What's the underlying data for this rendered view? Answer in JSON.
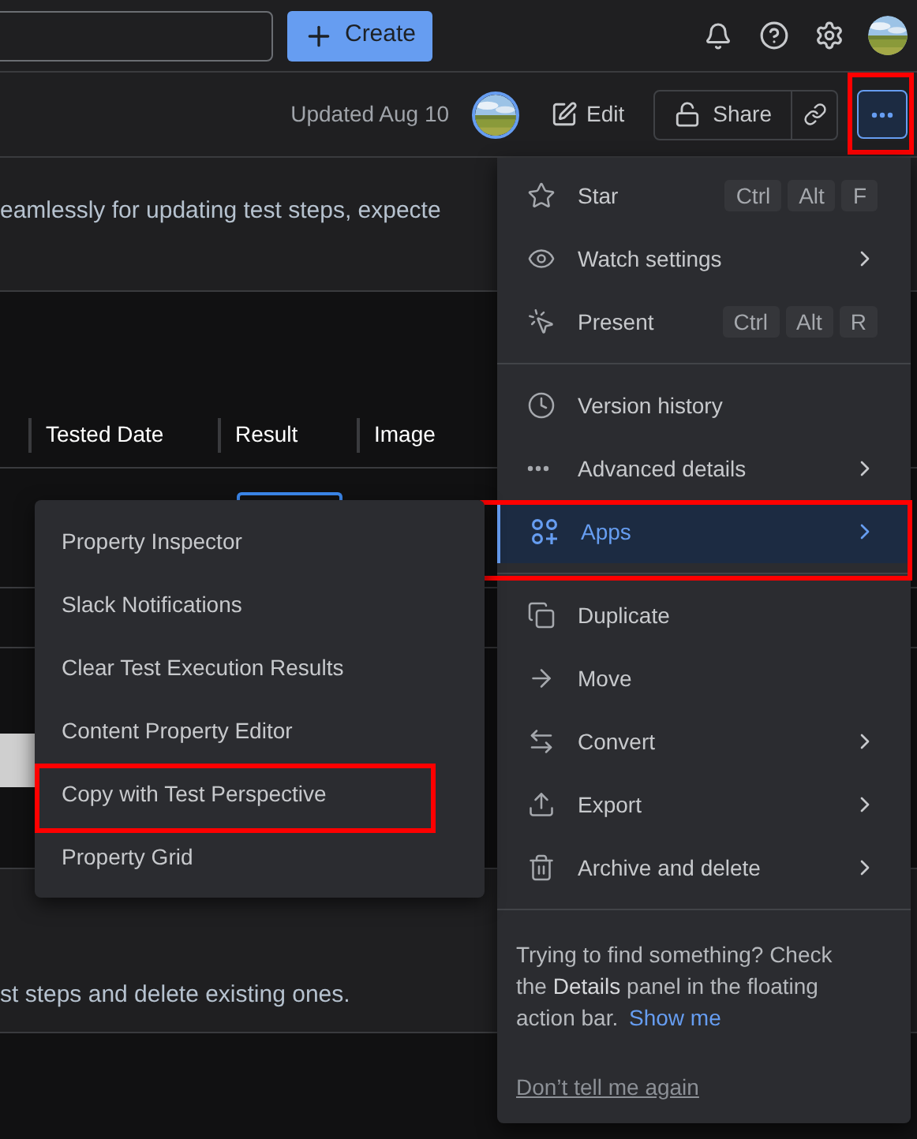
{
  "top_bar": {
    "create_button": "Create"
  },
  "page_header": {
    "updated": "Updated Aug 10",
    "edit_button": "Edit",
    "share_button": "Share",
    "more_button": {
      "selected": true,
      "highlighted": true
    }
  },
  "description_top": "eamlessly for updating test steps, expecte",
  "table": {
    "columns": [
      "Tested Date",
      "Result",
      "Image"
    ],
    "rows": [
      {
        "result_field": true
      }
    ]
  },
  "description_bottom": "st steps and delete existing ones.",
  "more_menu": {
    "sections": [
      [
        {
          "label": "Star",
          "kind": "star",
          "shortcut": [
            "Ctrl",
            "Alt",
            "F"
          ],
          "submenu": false,
          "selected": false,
          "highlighted": false
        },
        {
          "label": "Watch settings",
          "kind": "eye",
          "submenu": true,
          "selected": false,
          "highlighted": false
        },
        {
          "label": "Present",
          "kind": "pointer",
          "shortcut": [
            "Ctrl",
            "Alt",
            "R"
          ],
          "submenu": false,
          "selected": false,
          "highlighted": false
        }
      ],
      [
        {
          "label": "Version history",
          "kind": "clock",
          "submenu": false,
          "selected": false,
          "highlighted": false
        },
        {
          "label": "Advanced details",
          "kind": "dots",
          "submenu": true,
          "selected": false,
          "highlighted": false
        },
        {
          "label": "Apps",
          "kind": "apps",
          "submenu": true,
          "selected": true,
          "highlighted": true
        }
      ],
      [
        {
          "label": "Duplicate",
          "kind": "copy",
          "submenu": false,
          "selected": false,
          "highlighted": false
        },
        {
          "label": "Move",
          "kind": "arrow",
          "submenu": false,
          "selected": false,
          "highlighted": false
        },
        {
          "label": "Convert",
          "kind": "swap",
          "submenu": true,
          "selected": false,
          "highlighted": false
        },
        {
          "label": "Export",
          "kind": "upload",
          "submenu": true,
          "selected": false,
          "highlighted": false
        },
        {
          "label": "Archive and delete",
          "kind": "trash",
          "submenu": true,
          "selected": false,
          "highlighted": false
        }
      ]
    ],
    "tip": {
      "text": "Trying to find something? Check the **Details** panel in the floating action bar.",
      "link": "Show me",
      "dismiss": "Don’t tell me again"
    }
  },
  "apps_submenu": {
    "items": [
      {
        "label": "Property Inspector",
        "highlighted": false
      },
      {
        "label": "Slack Notifications",
        "highlighted": false
      },
      {
        "label": "Clear Test Execution Results",
        "highlighted": false
      },
      {
        "label": "Content Property Editor",
        "highlighted": false
      },
      {
        "label": "Copy with Test Perspective",
        "highlighted": true
      },
      {
        "label": "Property Grid",
        "highlighted": false
      }
    ]
  }
}
